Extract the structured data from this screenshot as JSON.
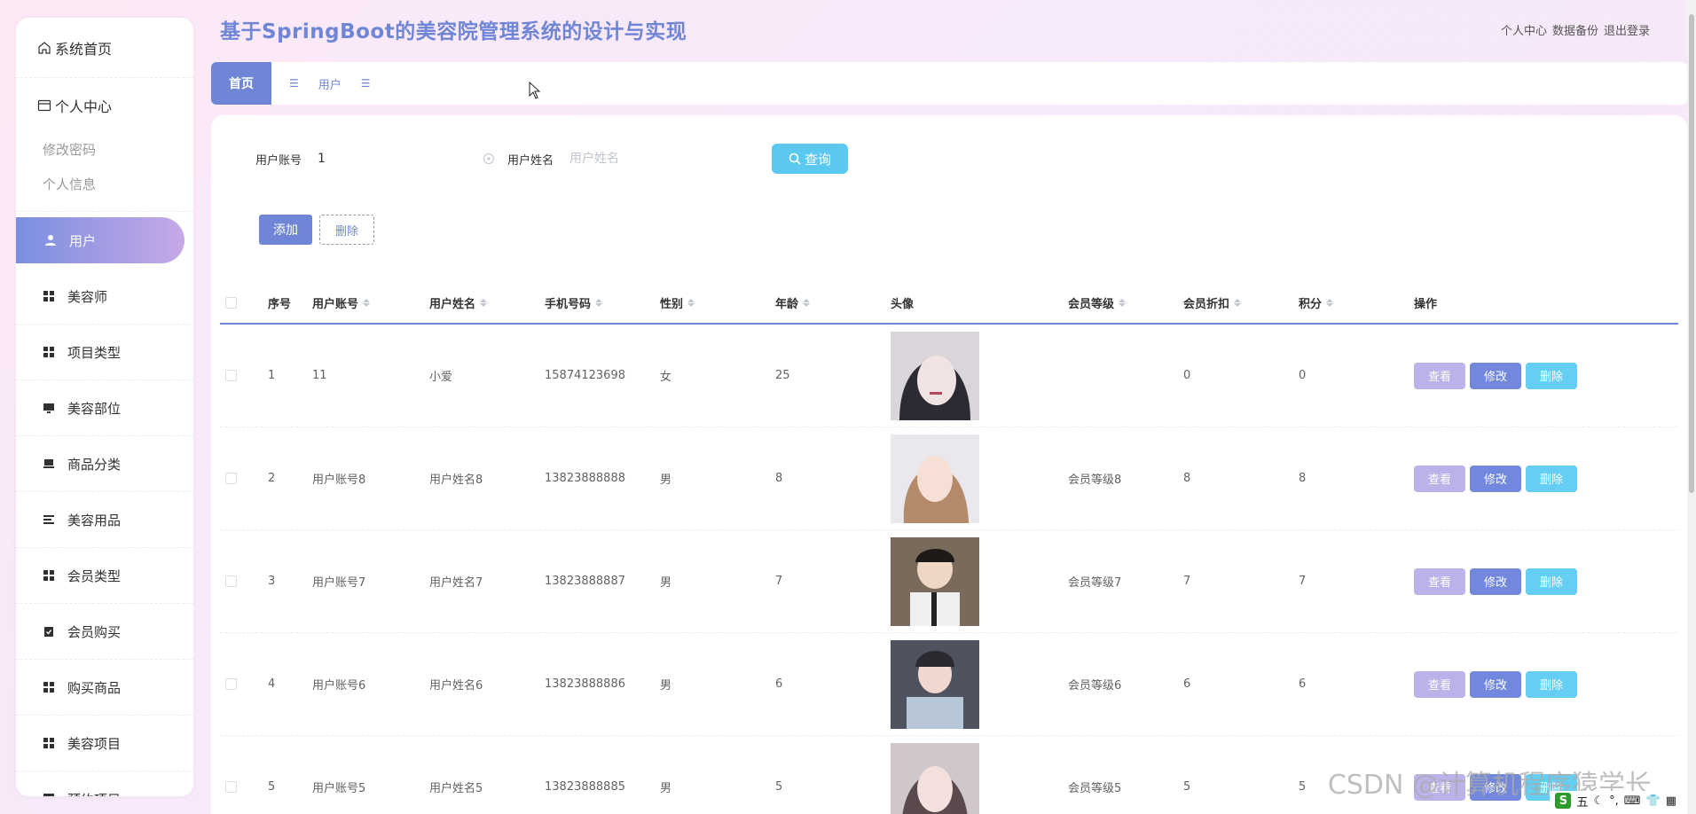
{
  "app": {
    "title": "基于SpringBoot的美容院管理系统的设计与实现",
    "header_links": [
      "个人中心",
      "数据备份",
      "退出登录"
    ]
  },
  "sidebar": {
    "home": "系统首页",
    "group": {
      "title": "个人中心",
      "items": [
        "修改密码",
        "个人信息"
      ]
    },
    "items": [
      {
        "label": "用户",
        "icon": "user-icon",
        "active": true
      },
      {
        "label": "美容师",
        "icon": "grid-icon"
      },
      {
        "label": "项目类型",
        "icon": "grid-icon"
      },
      {
        "label": "美容部位",
        "icon": "monitor-icon"
      },
      {
        "label": "商品分类",
        "icon": "tray-icon"
      },
      {
        "label": "美容用品",
        "icon": "list-icon"
      },
      {
        "label": "会员类型",
        "icon": "grid-icon"
      },
      {
        "label": "会员购买",
        "icon": "clipboard-check-icon"
      },
      {
        "label": "购买商品",
        "icon": "grid-icon"
      },
      {
        "label": "美容项目",
        "icon": "grid-icon"
      },
      {
        "label": "预约项目",
        "icon": "chart-icon"
      }
    ]
  },
  "tabs": {
    "home": "首页",
    "current": "用户"
  },
  "search": {
    "account_label": "用户账号",
    "account_value": "1",
    "name_label": "用户姓名",
    "name_placeholder": "用户姓名",
    "button": "查询"
  },
  "actions": {
    "add": "添加",
    "delete": "删除"
  },
  "table": {
    "headers": {
      "index": "序号",
      "account": "用户账号",
      "name": "用户姓名",
      "phone": "手机号码",
      "gender": "性别",
      "age": "年龄",
      "avatar": "头像",
      "level": "会员等级",
      "discount": "会员折扣",
      "points": "积分",
      "ops": "操作"
    },
    "op_labels": {
      "view": "查看",
      "edit": "修改",
      "delete": "删除"
    },
    "rows": [
      {
        "index": "1",
        "account": "11",
        "name": "小爱",
        "phone": "15874123698",
        "gender": "女",
        "age": "25",
        "level": "",
        "discount": "0",
        "points": "0"
      },
      {
        "index": "2",
        "account": "用户账号8",
        "name": "用户姓名8",
        "phone": "13823888888",
        "gender": "男",
        "age": "8",
        "level": "会员等级8",
        "discount": "8",
        "points": "8"
      },
      {
        "index": "3",
        "account": "用户账号7",
        "name": "用户姓名7",
        "phone": "13823888887",
        "gender": "男",
        "age": "7",
        "level": "会员等级7",
        "discount": "7",
        "points": "7"
      },
      {
        "index": "4",
        "account": "用户账号6",
        "name": "用户姓名6",
        "phone": "13823888886",
        "gender": "男",
        "age": "6",
        "level": "会员等级6",
        "discount": "6",
        "points": "6"
      },
      {
        "index": "5",
        "account": "用户账号5",
        "name": "用户姓名5",
        "phone": "13823888885",
        "gender": "男",
        "age": "5",
        "level": "会员等级5",
        "discount": "5",
        "points": "5"
      }
    ]
  },
  "watermark": "CSDN @计算机程序猿学长",
  "tray": {
    "ime": "五"
  },
  "colors": {
    "accent": "#6f86d6",
    "search_button": "#5bc8ef",
    "view_button": "#b9b3ea",
    "edit_button": "#7188dc",
    "delete_button": "#65cff3"
  }
}
